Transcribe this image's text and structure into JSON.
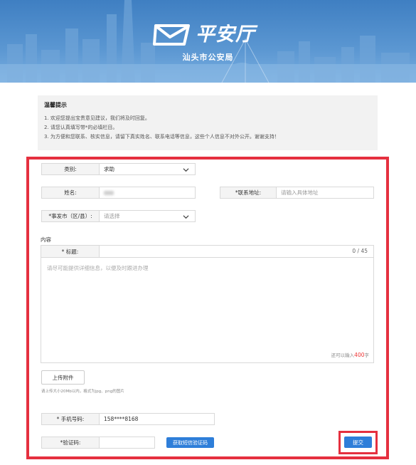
{
  "header": {
    "logo_text": "平安厅",
    "subtitle": "汕头市公安局"
  },
  "notice": {
    "title": "温馨提示",
    "lines": [
      "1. 欢迎您提出宝贵意见建议，我们将及时回复。",
      "2. 请您认真填写带*的必填栏目。",
      "3. 为方便和您联系、核实信息，请留下真实姓名、联系电话等信息，这些个人信息不对外公开。谢谢支持！"
    ]
  },
  "form": {
    "category": {
      "label": "类别:",
      "value": "求助"
    },
    "name": {
      "label": "姓名:"
    },
    "address": {
      "label": "*联系地址:",
      "placeholder": "请输入具体地址"
    },
    "city": {
      "label": "*事发市（区/县）:",
      "placeholder": "请选择"
    },
    "content_label": "内容",
    "title": {
      "label": "* 标题:",
      "count": "0 / 45"
    },
    "body": {
      "placeholder": "请尽可能提供详细信息，以便及时跟进办理",
      "remain_prefix": "还可以输入",
      "remain_num": "400",
      "remain_suffix": "字"
    },
    "upload": {
      "button": "上传附件",
      "tip": "请上传大小20Mb以内，格式为jpg、png的图片"
    },
    "phone": {
      "label": "* 手机号码:",
      "value": "158****8168"
    },
    "code": {
      "label": "*验证码:"
    },
    "sms_button": "获取短信验证码",
    "submit_button": "提交"
  },
  "colors": {
    "accent": "#2e7ed9",
    "highlight_frame": "#e5303f",
    "banner": "#4a88c8"
  }
}
